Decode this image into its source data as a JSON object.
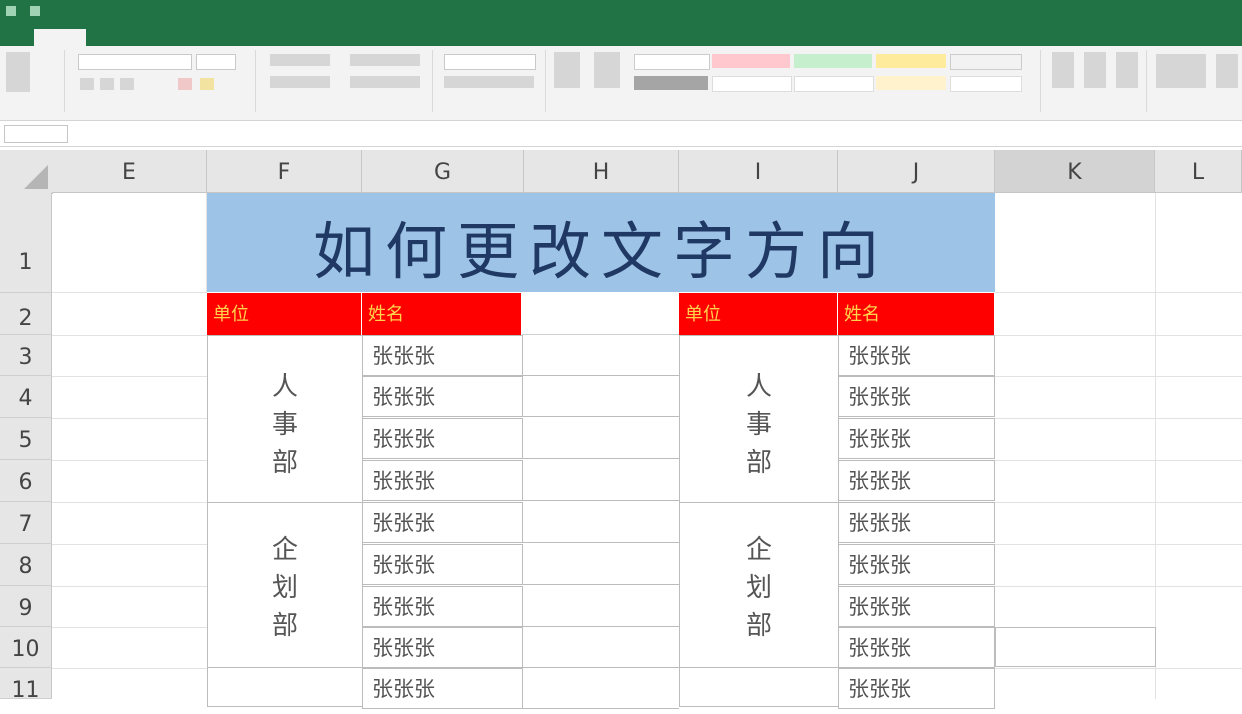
{
  "ribbon": {
    "tabs": [
      "",
      "",
      "",
      "",
      "",
      "",
      "",
      "",
      ""
    ],
    "active_tab_index": 1
  },
  "sheet": {
    "columns": [
      "E",
      "F",
      "G",
      "H",
      "I",
      "J",
      "K",
      "L"
    ],
    "selected_column": "K",
    "rows": [
      "1",
      "2",
      "3",
      "4",
      "5",
      "6",
      "7",
      "8",
      "9",
      "10",
      "11"
    ],
    "title": "如何更改文字方向",
    "left_table": {
      "headers": [
        "单位",
        "姓名"
      ],
      "units": [
        {
          "label": [
            "人",
            "事",
            "部"
          ],
          "names": [
            "张张张",
            "张张张",
            "张张张",
            "张张张"
          ]
        },
        {
          "label": [
            "企",
            "划",
            "部"
          ],
          "names": [
            "张张张",
            "张张张",
            "张张张",
            "张张张"
          ]
        }
      ],
      "extra_row_name": "张张张"
    },
    "right_table": {
      "headers": [
        "单位",
        "姓名"
      ],
      "units": [
        {
          "label": [
            "人",
            "事",
            "部"
          ],
          "names": [
            "张张张",
            "张张张",
            "张张张",
            "张张张"
          ]
        },
        {
          "label": [
            "企",
            "划",
            "部"
          ],
          "names": [
            "张张张",
            "张张张",
            "张张张",
            "张张张"
          ]
        }
      ],
      "extra_row_name": "张张张"
    }
  },
  "colors": {
    "excel_green": "#217346",
    "title_fill": "#9dc3e6",
    "title_text": "#1f3864",
    "header_fill": "#ff0000",
    "header_text": "#ffd24d"
  }
}
